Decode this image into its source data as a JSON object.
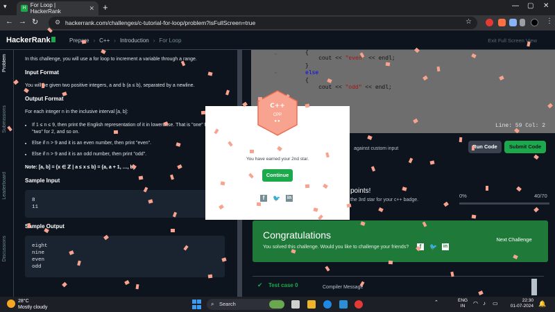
{
  "browser": {
    "tab_title": "For Loop | HackerRank",
    "favicon_text": "H",
    "url": "hackerrank.com/challenges/c-tutorial-for-loop/problem?isFullScreen=true"
  },
  "header": {
    "logo": "HackerRank",
    "breadcrumbs": [
      "Prepare",
      "C++",
      "Introduction",
      "For Loop"
    ],
    "exit_fullscreen": "Exit Full Screen View"
  },
  "rail": {
    "tabs": [
      "Problem",
      "Submissions",
      "Leaderboard",
      "Discussions"
    ]
  },
  "problem": {
    "intro": "In this challenge, you will use a for loop to increment a variable through a range.",
    "input_format_title": "Input Format",
    "input_format_text": "You will be given two positive integers, a and b (a ≤ b), separated by a newline.",
    "output_format_title": "Output Format",
    "output_format_text": "For each integer n in the inclusive interval [a, b]:",
    "bullets": [
      "If 1 ≤ n ≤ 9, then print the English representation of it in lowercase. That is \"one\" for 1, \"two\" for 2, and so on.",
      "Else if n > 9 and it is an even number, then print \"even\".",
      "Else if n > 9 and it is an odd number, then print \"odd\"."
    ],
    "note": "Note: [a, b] = {x ∈ ℤ | a ≤ x ≤ b} = {a, a + 1, …, b}",
    "sample_input_title": "Sample Input",
    "sample_input": [
      "8",
      "11"
    ],
    "sample_output_title": "Sample Output",
    "sample_output": [
      "eight",
      "nine",
      "even",
      "odd"
    ]
  },
  "editor": {
    "lines": [
      "{",
      "    cout << \"even\" << endl;",
      "}",
      "else",
      "{",
      "    cout << \"odd\" << endl;"
    ],
    "line_col": "Line: 59 Col: 2",
    "test_hint": "against custom input",
    "run_label": "Run Code",
    "submit_label": "Submit Code"
  },
  "result": {
    "points_text": "points!",
    "star_hint": "the 3rd star for your c++ badge.",
    "progress_start": "0%",
    "progress_end": "40/70",
    "progress_fraction": 0.0,
    "congrats_title": "Congratulations",
    "congrats_sub": "You solved this challenge. Would you like to challenge your friends?",
    "next_challenge": "Next Challenge",
    "test_case": "Test case 0",
    "compiler_message": "Compiler Message"
  },
  "modal": {
    "badge_lang": "C++",
    "badge_sub": "CPP",
    "badge_stars": "●●",
    "earned_text": "You have earned your 2nd star.",
    "continue_label": "Continue",
    "badge_color": "#f8a38f"
  },
  "taskbar": {
    "weather_temp": "28°C",
    "weather_desc": "Mostly cloudy",
    "search_label": "Search",
    "lang_1": "ENG",
    "lang_2": "IN",
    "time": "22:30",
    "date": "01-07-2024"
  },
  "colors": {
    "accent_green": "#1ba94c",
    "confetti": "#f8a38f",
    "dark_bg": "#0e141e"
  }
}
